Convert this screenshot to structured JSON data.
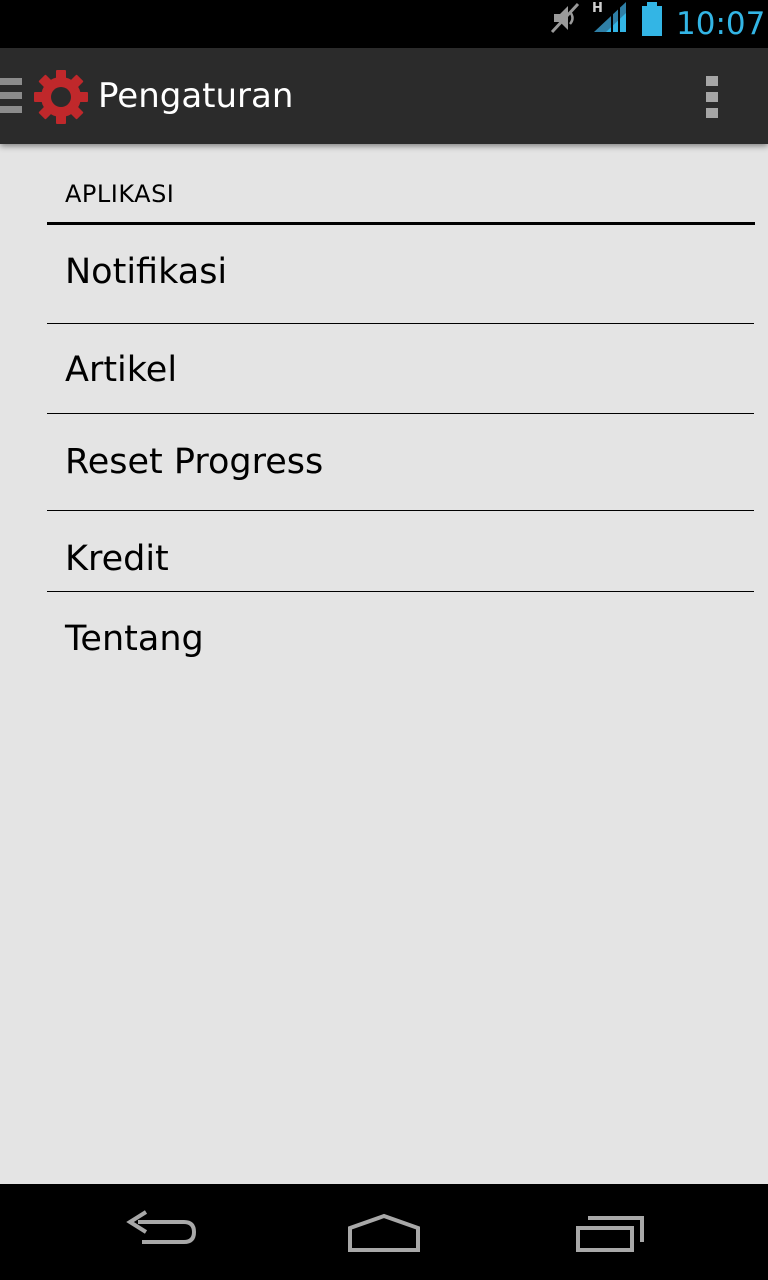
{
  "status_bar": {
    "time": "10:07",
    "icons": [
      "mute-icon",
      "signal-h-icon",
      "battery-icon"
    ],
    "accent_color": "#33b5e5"
  },
  "action_bar": {
    "title": "Pengaturan",
    "app_icon": "gear-icon",
    "app_icon_color": "#c0282b",
    "overflow_icon": "overflow-menu-icon"
  },
  "settings": {
    "category": "APLIKASI",
    "items": [
      {
        "label": "Notifikasi"
      },
      {
        "label": "Artikel"
      },
      {
        "label": "Reset Progress"
      },
      {
        "label": "Kredit"
      },
      {
        "label": "Tentang"
      }
    ]
  },
  "nav_bar": {
    "buttons": [
      "back-icon",
      "home-icon",
      "recents-icon"
    ]
  }
}
